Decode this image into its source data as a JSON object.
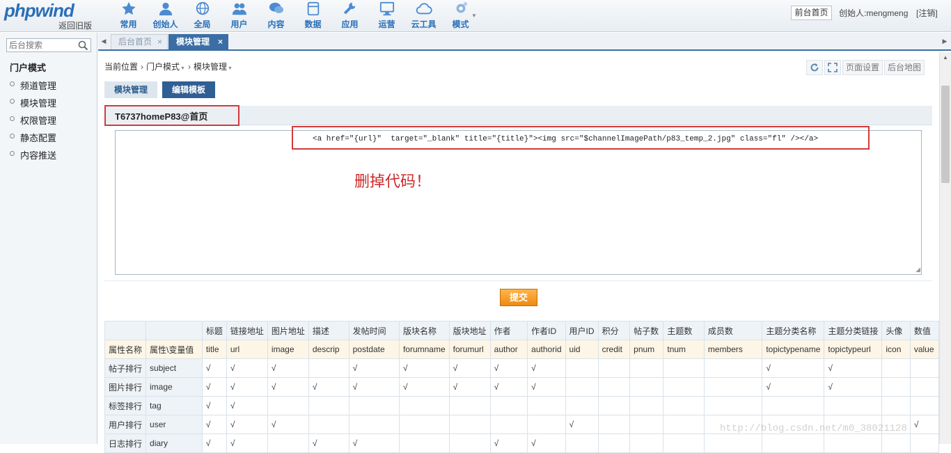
{
  "header": {
    "logo": "phpwind",
    "back_old": "返回旧版",
    "nav": [
      {
        "label": "常用",
        "icon": "star-icon"
      },
      {
        "label": "创始人",
        "icon": "user-icon"
      },
      {
        "label": "全局",
        "icon": "globe-icon"
      },
      {
        "label": "用户",
        "icon": "users-icon"
      },
      {
        "label": "内容",
        "icon": "chat-icon"
      },
      {
        "label": "数据",
        "icon": "database-icon"
      },
      {
        "label": "应用",
        "icon": "wrench-icon"
      },
      {
        "label": "运营",
        "icon": "monitor-icon"
      },
      {
        "label": "云工具",
        "icon": "cloud-icon"
      },
      {
        "label": "模式",
        "icon": "gear-icon"
      }
    ],
    "front_home": "前台首页",
    "founder": "创始人:mengmeng",
    "logout": "[注销]"
  },
  "sidebar": {
    "search_placeholder": "后台搜索",
    "title": "门户模式",
    "items": [
      "频道管理",
      "模块管理",
      "权限管理",
      "静态配置",
      "内容推送"
    ]
  },
  "tabs": {
    "inactive": "后台首页",
    "active": "模块管理"
  },
  "breadcrumb": {
    "root": "当前位置",
    "level1": "门户模式",
    "level2": "模块管理"
  },
  "toolbar": {
    "page_settings": "页面设置",
    "site_map": "后台地图"
  },
  "subtabs": [
    "模块管理",
    "编辑模板"
  ],
  "module_title": "T6737homeP83@首页",
  "editor": {
    "code": "<a href=\"{url}\"  target=\"_blank\" title=\"{title}\"><img src=\"$channelImagePath/p83_temp_2.jpg\" class=\"fl\" /></a>",
    "note": "删掉代码！"
  },
  "submit_label": "提交",
  "table": {
    "columns": [
      "标题",
      "链接地址",
      "图片地址",
      "描述",
      "发帖时间",
      "版块名称",
      "版块地址",
      "作者",
      "作者ID",
      "用户ID",
      "积分",
      "帖子数",
      "主题数",
      "成员数",
      "主题分类名称",
      "主题分类链接",
      "头像",
      "数值"
    ],
    "var_row": {
      "name": "属性名称",
      "var": "属性\\变量值",
      "values": [
        "title",
        "url",
        "image",
        "descrip",
        "postdate",
        "forumname",
        "forumurl",
        "author",
        "authorid",
        "uid",
        "credit",
        "pnum",
        "tnum",
        "members",
        "topictypename",
        "topictypeurl",
        "icon",
        "value"
      ]
    },
    "rows": [
      {
        "name": "帖子排行",
        "var": "subject",
        "checks": [
          "√",
          "√",
          "√",
          "",
          "√",
          "√",
          "√",
          "√",
          "√",
          "",
          "",
          "",
          "",
          "",
          "√",
          "√",
          "",
          ""
        ]
      },
      {
        "name": "图片排行",
        "var": "image",
        "checks": [
          "√",
          "√",
          "√",
          "√",
          "√",
          "√",
          "√",
          "√",
          "√",
          "",
          "",
          "",
          "",
          "",
          "√",
          "√",
          "",
          ""
        ]
      },
      {
        "name": "标签排行",
        "var": "tag",
        "checks": [
          "√",
          "√",
          "",
          "",
          "",
          "",
          "",
          "",
          "",
          "",
          "",
          "",
          "",
          "",
          "",
          "",
          "",
          ""
        ]
      },
      {
        "name": "用户排行",
        "var": "user",
        "checks": [
          "√",
          "√",
          "√",
          "",
          "",
          "",
          "",
          "",
          "",
          "√",
          "",
          "",
          "",
          "",
          "",
          "",
          "",
          "√"
        ]
      },
      {
        "name": "日志排行",
        "var": "diary",
        "checks": [
          "√",
          "√",
          "",
          "√",
          "√",
          "",
          "",
          "√",
          "√",
          "",
          "",
          "",
          "",
          "",
          "",
          "",
          "",
          ""
        ]
      }
    ]
  },
  "watermark": "http://blog.csdn.net/m0_38021128"
}
